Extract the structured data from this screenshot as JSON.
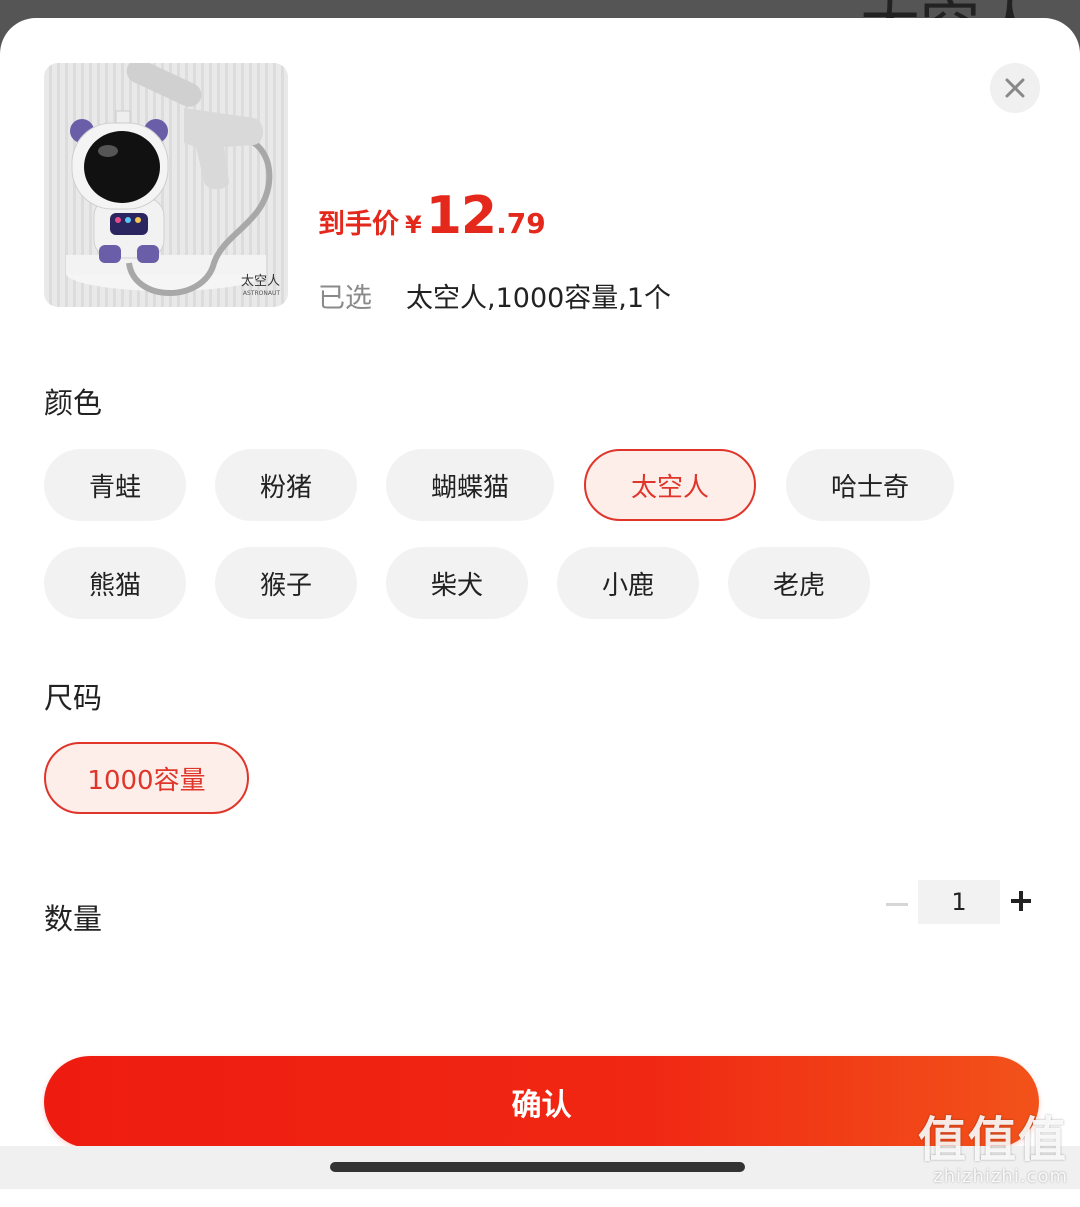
{
  "backdrop": {
    "text": "太空人"
  },
  "product": {
    "image_caption": "太空人",
    "image_caption_sub": "ASTRONAUT",
    "price_label": "到手价",
    "currency": "¥",
    "price_int": "12",
    "price_dec": ".79",
    "selected_label": "已选",
    "selected_value": "太空人,1000容量,1个"
  },
  "close": {
    "icon": "close-icon"
  },
  "color_section": {
    "title": "颜色",
    "options": [
      {
        "label": "青蛙",
        "selected": false
      },
      {
        "label": "粉猪",
        "selected": false
      },
      {
        "label": "蝴蝶猫",
        "selected": false
      },
      {
        "label": "太空人",
        "selected": true
      },
      {
        "label": "哈士奇",
        "selected": false
      },
      {
        "label": "熊猫",
        "selected": false
      },
      {
        "label": "猴子",
        "selected": false
      },
      {
        "label": "柴犬",
        "selected": false
      },
      {
        "label": "小鹿",
        "selected": false
      },
      {
        "label": "老虎",
        "selected": false
      }
    ]
  },
  "size_section": {
    "title": "尺码",
    "options": [
      {
        "label": "1000容量",
        "selected": true
      }
    ]
  },
  "quantity": {
    "title": "数量",
    "value": "1"
  },
  "confirm": {
    "label": "确认"
  },
  "watermark": {
    "main": "值值值",
    "sub": "zhizhizhi.com"
  },
  "colors": {
    "accent": "#e0352a",
    "confirm_start": "#ee1c10",
    "confirm_end": "#f2531a",
    "chip_bg": "#f2f2f2"
  }
}
